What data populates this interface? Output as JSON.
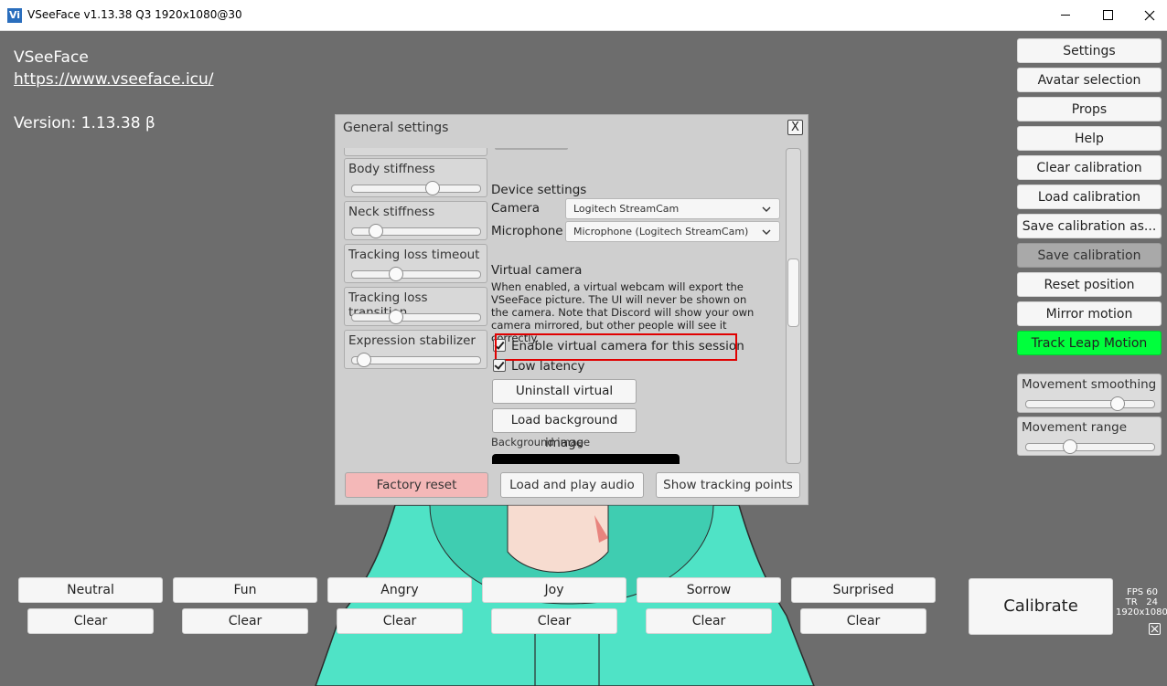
{
  "window": {
    "title": "VSeeFace v1.13.38 Q3 1920x1080@30",
    "icon_text": "Vi",
    "minimize_icon": "minimize-icon",
    "maximize_icon": "maximize-icon",
    "close_icon": "close-icon"
  },
  "info": {
    "app_name": "VSeeFace",
    "url": "https://www.vseeface.icu/",
    "version": "Version: 1.13.38 β"
  },
  "side_menu": {
    "buttons": [
      {
        "label": "Settings",
        "state": "normal"
      },
      {
        "label": "Avatar selection",
        "state": "normal"
      },
      {
        "label": "Props",
        "state": "normal"
      },
      {
        "label": "Help",
        "state": "normal"
      },
      {
        "label": "Clear calibration",
        "state": "normal"
      },
      {
        "label": "Load calibration",
        "state": "normal"
      },
      {
        "label": "Save calibration as...",
        "state": "normal"
      },
      {
        "label": "Save calibration",
        "state": "disabled"
      },
      {
        "label": "Reset position",
        "state": "normal"
      },
      {
        "label": "Mirror motion",
        "state": "normal"
      },
      {
        "label": "Track Leap Motion",
        "state": "active"
      }
    ],
    "sliders": [
      {
        "label": "Movement smoothing",
        "value": 0.75
      },
      {
        "label": "Movement range",
        "value": 0.33
      }
    ],
    "active_color": "#00ff3c"
  },
  "dialog": {
    "title": "General settings",
    "close_label": "X",
    "left_sliders": [
      {
        "label": "Body stiffness",
        "value": 0.65
      },
      {
        "label": "Neck stiffness",
        "value": 0.15
      },
      {
        "label": "Tracking loss timeout",
        "value": 0.33
      },
      {
        "label": "Tracking loss transition",
        "value": 0.33
      },
      {
        "label": "Expression stabilizer",
        "value": 0.05
      }
    ],
    "device_settings": {
      "heading": "Device settings",
      "camera_label": "Camera",
      "camera_value": "Logitech StreamCam",
      "microphone_label": "Microphone",
      "microphone_value": "Microphone (Logitech StreamCam)",
      "chevron_icon": "chevron-down-icon"
    },
    "virtual_camera": {
      "heading": "Virtual camera",
      "description": "When enabled, a virtual webcam will export the VSeeFace picture. The UI will never be shown on the camera. Note that Discord will show your own camera mirrored, but other people will see it correctly.",
      "enable_label": "Enable virtual camera for this session",
      "enable_checked": true,
      "low_latency_label": "Low latency",
      "low_latency_checked": true,
      "uninstall_label": "Uninstall virtual camera",
      "load_bg_label": "Load background image",
      "bg_image_label": "Background image"
    },
    "footer": {
      "factory_reset": "Factory reset",
      "load_audio": "Load and play audio",
      "show_points": "Show tracking points",
      "factory_reset_color": "#f4b8b8"
    },
    "highlight_color": "#e00000"
  },
  "expressions": {
    "labels": [
      "Neutral",
      "Fun",
      "Angry",
      "Joy",
      "Sorrow",
      "Surprised"
    ],
    "clear_label": "Clear"
  },
  "calibrate": {
    "label": "Calibrate"
  },
  "stats": {
    "fps_label": "FPS",
    "fps_value": "60",
    "tr_label": "TR",
    "tr_value": "24",
    "resolution": "1920x1080"
  },
  "avatar": {
    "hoodie_color": "#4fe3c6",
    "skin_color": "#f7dcd0"
  }
}
